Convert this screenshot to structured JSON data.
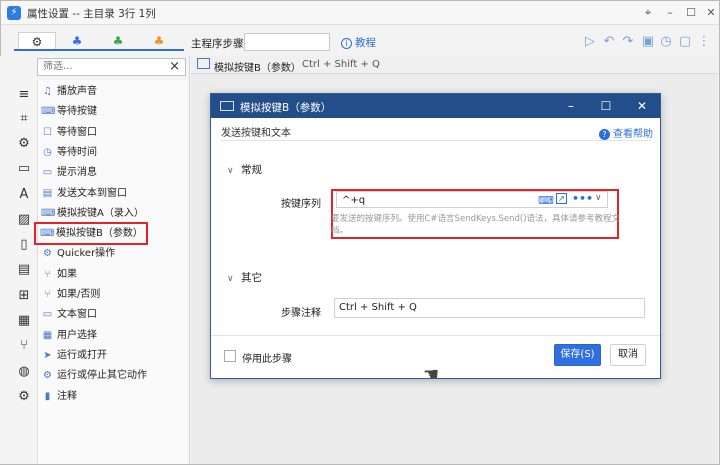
{
  "window": {
    "title": "属性设置 -- 主目录 3行 1列",
    "app_icon": "⚡"
  },
  "toolbar": {
    "main_steps_label": "主程序步骤:",
    "main_steps_value": "",
    "tutorial_label": "教程",
    "tabs": [
      {
        "icon": "gears-icon",
        "glyph": "⚙",
        "color": "#333333"
      },
      {
        "icon": "blue-cubes-icon",
        "glyph": "♣",
        "color": "#3a6fd8"
      },
      {
        "icon": "green-cubes-icon",
        "glyph": "♣",
        "color": "#3aa84a"
      },
      {
        "icon": "orange-cubes-icon",
        "glyph": "♣",
        "color": "#e8962a"
      }
    ]
  },
  "search": {
    "placeholder": "筛选...",
    "clear": "×"
  },
  "list_items": [
    {
      "label": "播放声音",
      "glyph": "♫"
    },
    {
      "label": "等待按键",
      "glyph": "⌨"
    },
    {
      "label": "等待窗口",
      "glyph": "☐"
    },
    {
      "label": "等待时间",
      "glyph": "◷"
    },
    {
      "label": "提示消息",
      "glyph": "▭"
    },
    {
      "label": "发送文本到窗口",
      "glyph": "▤"
    },
    {
      "label": "模拟按键A（录入）",
      "glyph": "⌨"
    },
    {
      "label": "模拟按键B（参数）",
      "glyph": "⌨"
    },
    {
      "label": "Quicker操作",
      "glyph": "⚙"
    },
    {
      "label": "如果",
      "glyph": "⑂"
    },
    {
      "label": "如果/否则",
      "glyph": "⑂"
    },
    {
      "label": "文本窗口",
      "glyph": "▭"
    },
    {
      "label": "用户选择",
      "glyph": "▦"
    },
    {
      "label": "运行或打开",
      "glyph": "➤"
    },
    {
      "label": "运行或停止其它动作",
      "glyph": "⚙"
    },
    {
      "label": "注释",
      "glyph": "▮"
    }
  ],
  "breadcrumb": {
    "title": "模拟按键B（参数）",
    "hotkey": "Ctrl + Shift + Q"
  },
  "dialog": {
    "title": "模拟按键B（参数）",
    "subtitle": "发送按键和文本",
    "help_label": "查看帮助",
    "section_general": "常规",
    "hotkey_label": "按键序列",
    "hotkey_value": "^+q",
    "hotkey_help": "要发送的按键序列。使用C#语言SendKeys.Send()语法，具体请参考教程文档。",
    "section_other": "其它",
    "note_label": "步骤注释",
    "note_value": "Ctrl + Shift + Q",
    "disable_label": "停用此步骤",
    "save_label": "保存(S)",
    "cancel_label": "取消"
  },
  "colors": {
    "accent": "#2f6fe0",
    "dialog_title_bg": "#234e8a",
    "highlight_red": "#e0242a"
  }
}
